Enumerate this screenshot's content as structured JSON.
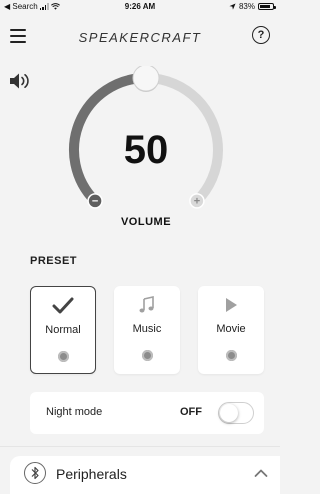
{
  "status": {
    "back_label": "◀ Search",
    "time": "9:26 AM",
    "battery": "83%",
    "battery_level": 0.83
  },
  "header": {
    "brand": "SPEAKERCRAFT",
    "help_label": "?"
  },
  "volume": {
    "value": "50",
    "label": "VOLUME",
    "level": 0.5,
    "minus_label": "−",
    "plus_label": "+"
  },
  "preset": {
    "title": "PRESET",
    "items": [
      {
        "label": "Normal",
        "icon": "checkmark-icon",
        "selected": true
      },
      {
        "label": "Music",
        "icon": "music-note-icon",
        "selected": false
      },
      {
        "label": "Movie",
        "icon": "play-icon",
        "selected": false
      }
    ]
  },
  "night_mode": {
    "label": "Night mode",
    "state": "OFF"
  },
  "peripherals": {
    "label": "Peripherals"
  },
  "colors": {
    "arc_active": "#6f6f6f",
    "arc_track": "#d6d6d6",
    "background": "#f3f3f3",
    "card": "#ffffff"
  }
}
